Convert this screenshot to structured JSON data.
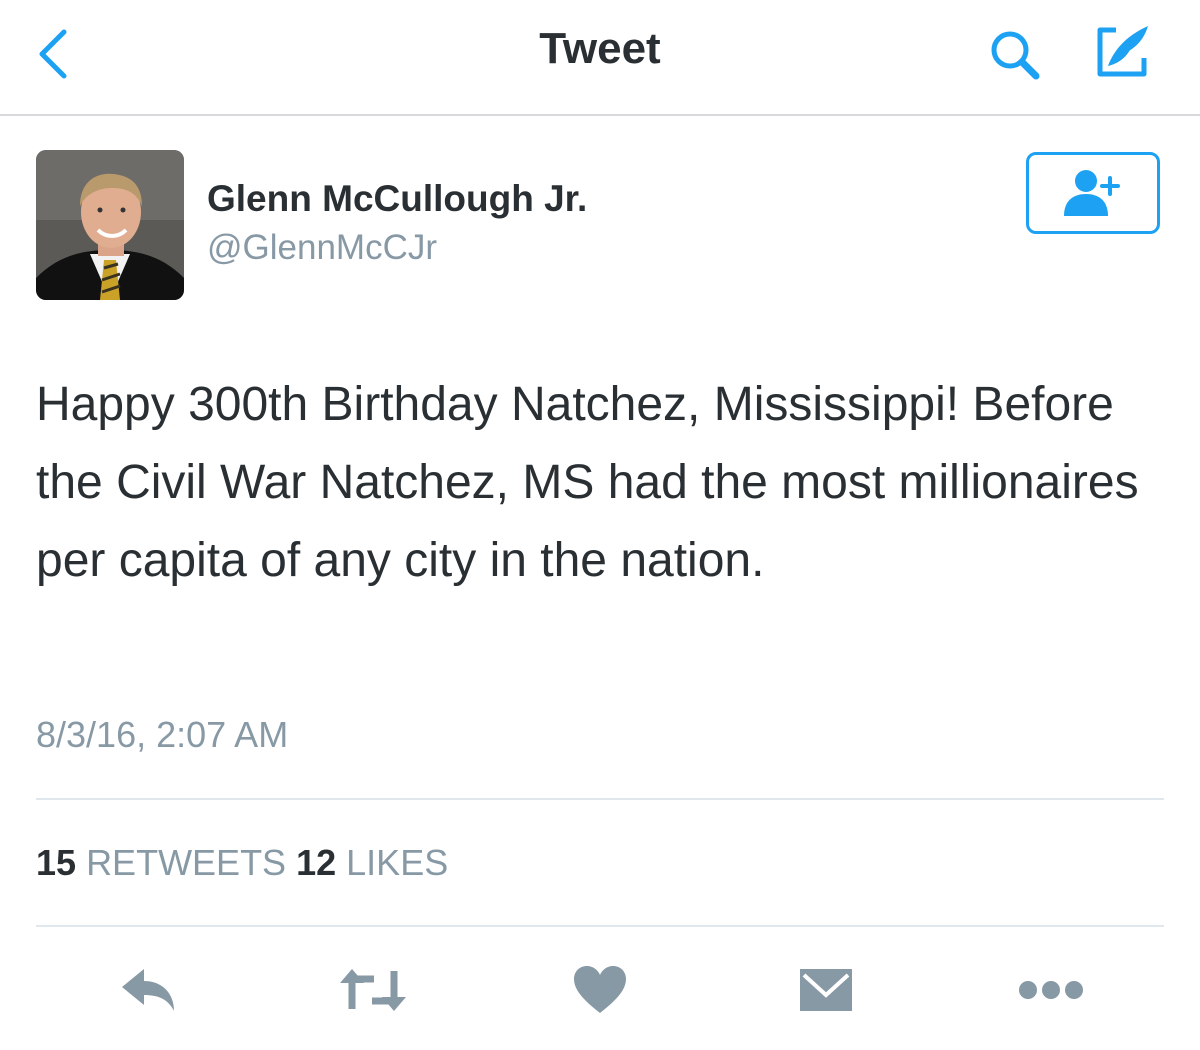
{
  "navbar": {
    "title": "Tweet",
    "back_icon": "chevron-left-icon",
    "search_icon": "search-icon",
    "compose_icon": "compose-icon",
    "accent": "#1da1f2"
  },
  "author": {
    "name": "Glenn McCullough Jr.",
    "handle": "@GlennMcCJr",
    "follow_icon": "add-user-icon"
  },
  "tweet": {
    "text": "Happy 300th Birthday Natchez, Mississippi! Before the Civil War Natchez, MS had the most millionaires per capita of any city in the nation.",
    "timestamp": "8/3/16, 2:07 AM"
  },
  "stats": {
    "retweets_count": "15",
    "retweets_label": "RETWEETS",
    "likes_count": "12",
    "likes_label": "LIKES"
  },
  "actions": [
    "reply-icon",
    "retweet-icon",
    "heart-icon",
    "envelope-icon",
    "more-icon"
  ],
  "colors": {
    "text": "#292f33",
    "secondary_text": "#8899a6",
    "action_icons": "#8899a6",
    "divider": "#e1e8ed"
  }
}
